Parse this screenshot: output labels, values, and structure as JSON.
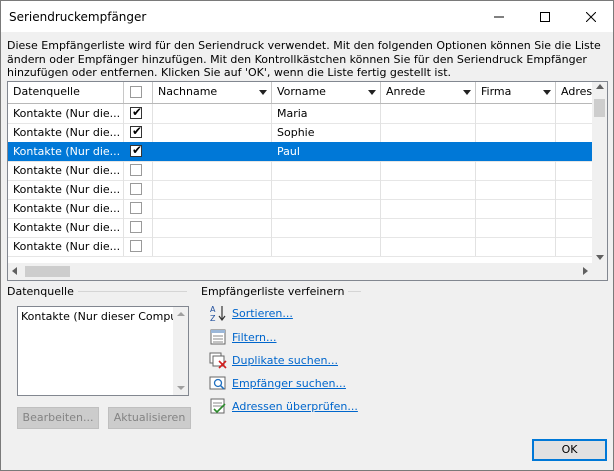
{
  "window": {
    "title": "Seriendruckempfänger"
  },
  "description": "Diese Empfängerliste wird für den Seriendruck verwendet. Mit den folgenden Optionen können Sie die Liste ändern oder Empfänger hinzufügen. Mit den Kontrollkästchen können Sie für den Seriendruck Empfänger hinzufügen oder entfernen. Klicken Sie auf 'OK', wenn die Liste fertig gestellt ist.",
  "grid": {
    "columns": [
      "Datenquelle",
      "",
      "Nachname",
      "Vorname",
      "Anrede",
      "Firma",
      "Adress"
    ],
    "rows": [
      {
        "source": "Kontakte (Nur die...",
        "checked": true,
        "nachname": "",
        "vorname": "Maria",
        "anrede": "",
        "firma": ""
      },
      {
        "source": "Kontakte (Nur die...",
        "checked": true,
        "nachname": "",
        "vorname": "Sophie",
        "anrede": "",
        "firma": ""
      },
      {
        "source": "Kontakte (Nur die...",
        "checked": true,
        "nachname": "",
        "vorname": "Paul",
        "anrede": "",
        "firma": "",
        "selected": true
      },
      {
        "source": "Kontakte (Nur die...",
        "checked": false,
        "nachname": "",
        "vorname": "",
        "anrede": "",
        "firma": ""
      },
      {
        "source": "Kontakte (Nur die...",
        "checked": false,
        "nachname": "",
        "vorname": "",
        "anrede": "",
        "firma": ""
      },
      {
        "source": "Kontakte (Nur die...",
        "checked": false,
        "nachname": "",
        "vorname": "",
        "anrede": "",
        "firma": ""
      },
      {
        "source": "Kontakte (Nur die...",
        "checked": false,
        "nachname": "",
        "vorname": "",
        "anrede": "",
        "firma": ""
      },
      {
        "source": "Kontakte (Nur die...",
        "checked": false,
        "nachname": "",
        "vorname": "",
        "anrede": "",
        "firma": ""
      }
    ]
  },
  "datasource": {
    "label": "Datenquelle",
    "items": [
      "Kontakte (Nur dieser Computer)"
    ],
    "edit_button": "Bearbeiten...",
    "refresh_button": "Aktualisieren"
  },
  "refine": {
    "label": "Empfängerliste verfeinern",
    "links": [
      {
        "label": "Sortieren...",
        "icon": "sort-az-icon"
      },
      {
        "label": "Filtern...",
        "icon": "filter-icon"
      },
      {
        "label": "Duplikate suchen...",
        "icon": "duplicates-icon"
      },
      {
        "label": "Empfänger suchen...",
        "icon": "find-recipient-icon"
      },
      {
        "label": "Adressen überprüfen...",
        "icon": "validate-addresses-icon"
      }
    ]
  },
  "ok_button": "OK",
  "colors": {
    "selection": "#0078d7",
    "link": "#0066cc"
  }
}
